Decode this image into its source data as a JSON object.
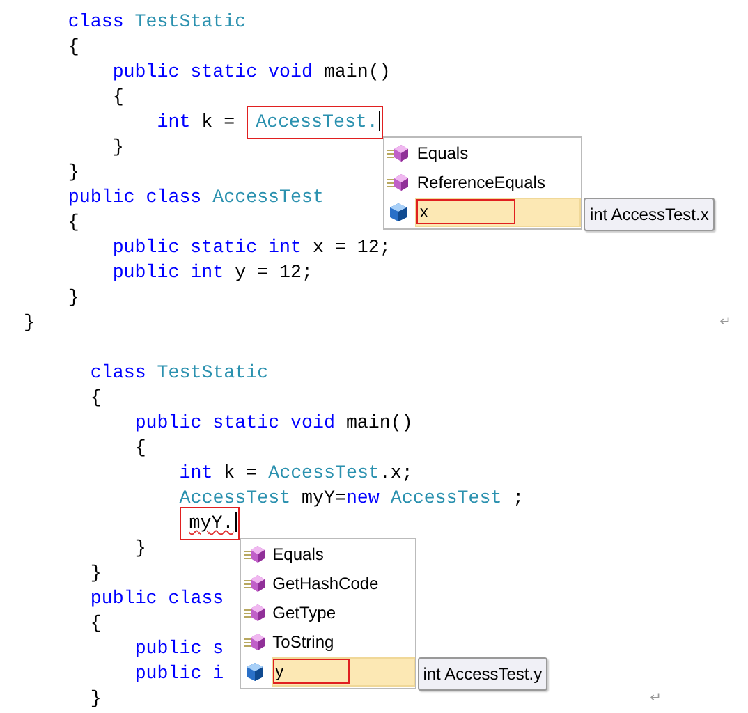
{
  "blocks": [
    {
      "lines": [
        {
          "children": [
            {
              "tokens": [
                {
                  "text": "class",
                  "kind": "keyword"
                },
                {
                  "text": " TestStatic",
                  "kind": "type"
                }
              ]
            },
            {
              "tokens": [
                {
                  "text": "{",
                  "kind": "plain"
                }
              ]
            },
            {
              "children": [
                {
                  "tokens": [
                    {
                      "text": "public static void",
                      "kind": "keyword"
                    },
                    {
                      "text": " main()",
                      "kind": "plain"
                    }
                  ]
                },
                {
                  "tokens": [
                    {
                      "text": "{",
                      "kind": "plain"
                    }
                  ]
                },
                {
                  "children": [
                    {
                      "tokens": [
                        {
                          "text": "int",
                          "kind": "keyword"
                        },
                        {
                          "text": " k = ",
                          "kind": "plain"
                        },
                        {
                          "text": "AccessTest.",
                          "kind": "type",
                          "boxed": true,
                          "caret": true,
                          "popup": {
                            "items": [
                              {
                                "label": "Equals",
                                "kind": "method",
                                "selected": false
                              },
                              {
                                "label": "ReferenceEquals",
                                "kind": "method",
                                "selected": false
                              },
                              {
                                "label": "x",
                                "kind": "field",
                                "selected": true
                              }
                            ],
                            "tooltip": "int AccessTest.x"
                          }
                        }
                      ]
                    }
                  ]
                },
                {
                  "tokens": [
                    {
                      "text": "}",
                      "kind": "plain"
                    }
                  ]
                }
              ]
            },
            {
              "tokens": [
                {
                  "text": "}",
                  "kind": "plain"
                }
              ]
            },
            {
              "tokens": [
                {
                  "text": "public class",
                  "kind": "keyword"
                },
                {
                  "text": " AccessTest",
                  "kind": "type"
                }
              ]
            },
            {
              "tokens": [
                {
                  "text": "{",
                  "kind": "plain"
                }
              ]
            },
            {
              "children": [
                {
                  "tokens": [
                    {
                      "text": "public static int",
                      "kind": "keyword"
                    },
                    {
                      "text": " x = 12;",
                      "kind": "plain"
                    }
                  ]
                },
                {
                  "tokens": [
                    {
                      "text": "public int",
                      "kind": "keyword"
                    },
                    {
                      "text": " y = 12;",
                      "kind": "plain"
                    }
                  ]
                }
              ]
            },
            {
              "tokens": [
                {
                  "text": "}",
                  "kind": "plain"
                }
              ]
            }
          ]
        },
        {
          "tokens": [
            {
              "text": "}",
              "kind": "plain"
            }
          ]
        }
      ],
      "end_mark": "↵"
    },
    {
      "lines": [
        {
          "children": [
            {
              "tokens": [
                {
                  "text": "class",
                  "kind": "keyword"
                },
                {
                  "text": " TestStatic",
                  "kind": "type"
                }
              ]
            },
            {
              "tokens": [
                {
                  "text": "{",
                  "kind": "plain"
                }
              ]
            },
            {
              "children": [
                {
                  "tokens": [
                    {
                      "text": "public static void",
                      "kind": "keyword"
                    },
                    {
                      "text": " main()",
                      "kind": "plain"
                    }
                  ]
                },
                {
                  "tokens": [
                    {
                      "text": "{",
                      "kind": "plain"
                    }
                  ]
                },
                {
                  "children": [
                    {
                      "tokens": [
                        {
                          "text": "int",
                          "kind": "keyword"
                        },
                        {
                          "text": " k = ",
                          "kind": "plain"
                        },
                        {
                          "text": "AccessTest",
                          "kind": "type"
                        },
                        {
                          "text": ".x;",
                          "kind": "plain"
                        }
                      ]
                    },
                    {
                      "tokens": [
                        {
                          "text": "AccessTest",
                          "kind": "type"
                        },
                        {
                          "text": " myY=",
                          "kind": "plain"
                        },
                        {
                          "text": "new",
                          "kind": "keyword"
                        },
                        {
                          "text": " AccessTest",
                          "kind": "type"
                        },
                        {
                          "text": " ;",
                          "kind": "plain"
                        }
                      ]
                    },
                    {
                      "tokens": [
                        {
                          "text": "myY.",
                          "kind": "plain",
                          "boxed": true,
                          "caret": true,
                          "squiggle": true,
                          "popup": {
                            "items": [
                              {
                                "label": "Equals",
                                "kind": "method",
                                "selected": false
                              },
                              {
                                "label": "GetHashCode",
                                "kind": "method",
                                "selected": false
                              },
                              {
                                "label": "GetType",
                                "kind": "method",
                                "selected": false
                              },
                              {
                                "label": "ToString",
                                "kind": "method",
                                "selected": false
                              },
                              {
                                "label": "y",
                                "kind": "field",
                                "selected": true
                              }
                            ],
                            "tooltip": "int AccessTest.y"
                          }
                        }
                      ]
                    }
                  ]
                },
                {
                  "tokens": [
                    {
                      "text": "}",
                      "kind": "plain"
                    }
                  ]
                }
              ]
            },
            {
              "tokens": [
                {
                  "text": "}",
                  "kind": "plain"
                }
              ]
            },
            {
              "tokens": [
                {
                  "text": "public class",
                  "kind": "keyword"
                }
              ]
            },
            {
              "tokens": [
                {
                  "text": "{",
                  "kind": "plain"
                }
              ]
            },
            {
              "children": [
                {
                  "tokens": [
                    {
                      "text": "public s",
                      "kind": "keyword"
                    }
                  ]
                },
                {
                  "tokens": [
                    {
                      "text": "public i",
                      "kind": "keyword"
                    }
                  ]
                }
              ]
            },
            {
              "tokens": [
                {
                  "text": "}",
                  "kind": "plain"
                }
              ]
            }
          ]
        }
      ],
      "end_mark": "↵"
    }
  ]
}
